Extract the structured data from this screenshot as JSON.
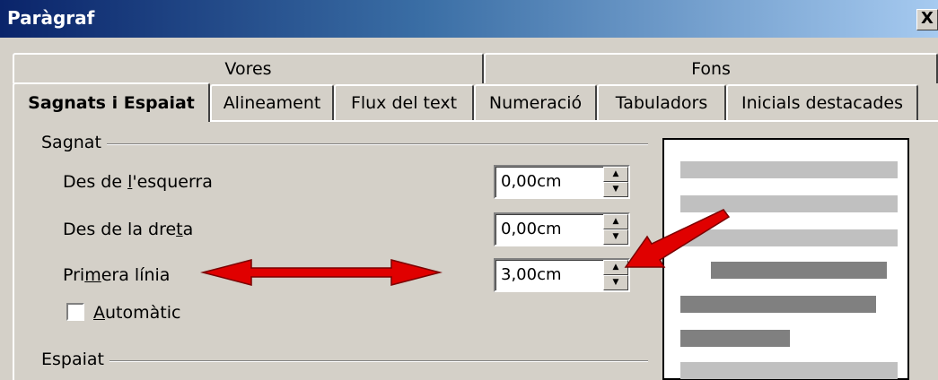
{
  "window": {
    "title": "Paràgraf",
    "close_label": "X"
  },
  "tabs_row1": [
    {
      "label": "Vores"
    },
    {
      "label": "Fons"
    }
  ],
  "tabs_row2": [
    {
      "label": "Sagnats i Espaiat",
      "active": true
    },
    {
      "label": "Alineament"
    },
    {
      "label": "Flux del text"
    },
    {
      "label": "Numeració"
    },
    {
      "label": "Tabuladors"
    },
    {
      "label": "Inicials destacades"
    }
  ],
  "indent": {
    "group_label": "Sagnat",
    "before_text": {
      "label_pre": "Des de ",
      "label_key": "l",
      "label_post": "'esquerra",
      "value": "0,00cm"
    },
    "after_text": {
      "label_pre": "Des de la dre",
      "label_key": "t",
      "label_post": "a",
      "value": "0,00cm"
    },
    "first_line": {
      "label_pre": "Pri",
      "label_key": "m",
      "label_post": "era línia",
      "value": "3,00cm"
    },
    "automatic": {
      "label_key": "A",
      "label_post": "utomàtic",
      "checked": false
    }
  },
  "spacing": {
    "group_label": "Espaiat"
  },
  "colors": {
    "arrow": "#e00000",
    "preview_light": "#c0c0c0",
    "preview_dark": "#808080"
  }
}
